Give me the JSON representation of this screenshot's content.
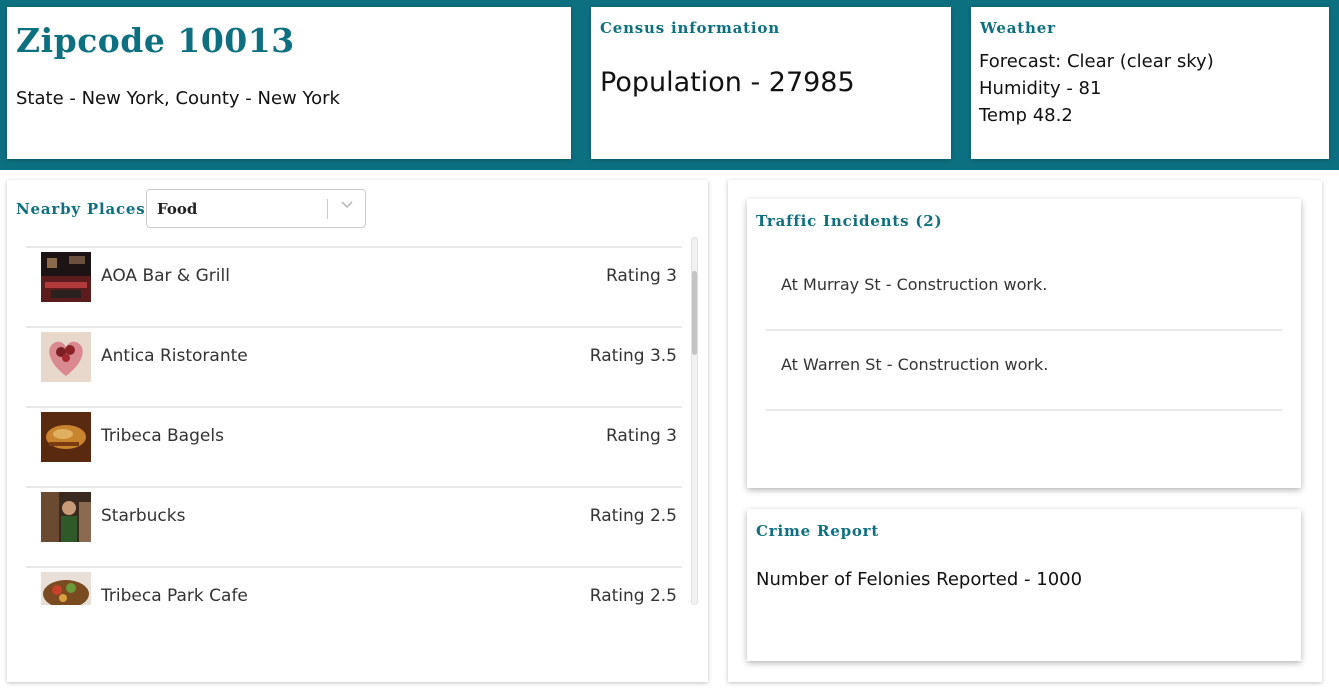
{
  "header": {
    "zip_title": "Zipcode 10013",
    "location_line": "State - New York, County - New York"
  },
  "census": {
    "heading": "Census information",
    "population": "Population - 27985"
  },
  "weather": {
    "heading": "Weather",
    "forecast": "Forecast: Clear (clear sky)",
    "humidity": "Humidity - 81",
    "temp": "Temp 48.2"
  },
  "nearby": {
    "label": "Nearby Places",
    "category_selected": "Food",
    "chevron_icon": "chevron-down-icon",
    "items": [
      {
        "name": "AOA Bar & Grill",
        "rating": "Rating 3"
      },
      {
        "name": "Antica Ristorante",
        "rating": "Rating 3.5"
      },
      {
        "name": "Tribeca Bagels",
        "rating": "Rating 3"
      },
      {
        "name": "Starbucks",
        "rating": "Rating 2.5"
      },
      {
        "name": "Tribeca Park Cafe",
        "rating": "Rating 2.5"
      }
    ]
  },
  "traffic": {
    "heading": "Traffic Incidents (2)",
    "incidents": [
      {
        "text": "At Murray St - Construction work."
      },
      {
        "text": "At Warren St - Construction work."
      }
    ]
  },
  "crime": {
    "heading": "Crime Report",
    "felonies": "Number of Felonies Reported - 1000"
  },
  "colors": {
    "accent": "#0d7080",
    "divider": "#e8e8e8"
  }
}
